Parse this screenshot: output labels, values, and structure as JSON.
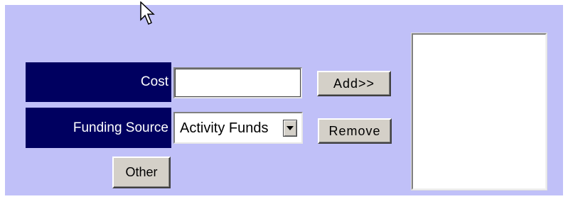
{
  "form": {
    "cost_label": "Cost",
    "cost_value": "",
    "funding_label": "Funding Source",
    "funding_selected": "Activity Funds",
    "other_button": "Other",
    "add_button": "Add>>",
    "remove_button": "Remove"
  },
  "selected_list": {
    "items": []
  },
  "colors": {
    "panel_bg": "#c0c0f8",
    "label_bg": "#000060",
    "label_text": "#ffffff",
    "button_bg": "#d4d0c8"
  },
  "icons": {
    "cursor": "mouse-pointer-icon",
    "dropdown": "chevron-down-icon"
  }
}
